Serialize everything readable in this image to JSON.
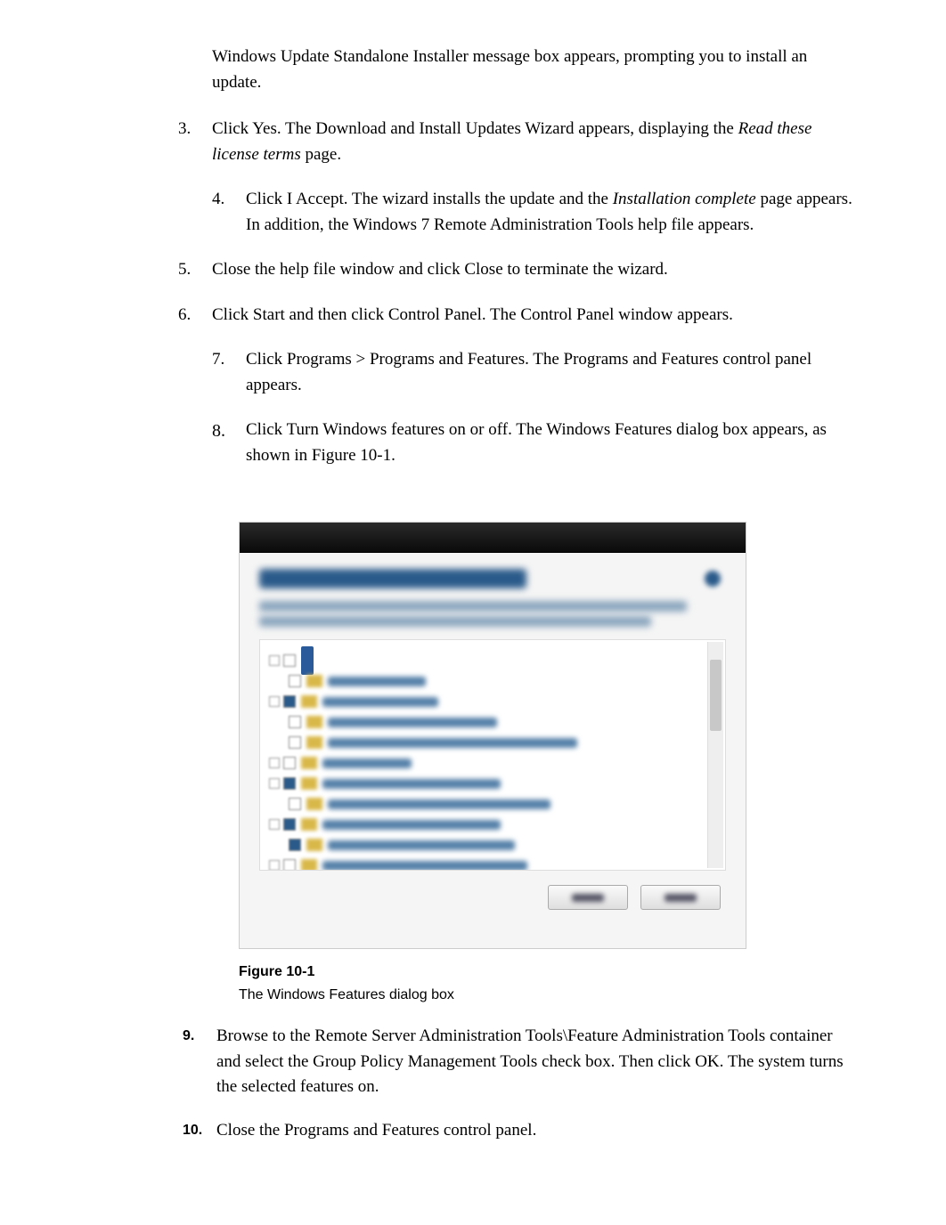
{
  "intro": "Windows Update Standalone Installer message box appears, prompting you to install an update.",
  "steps": {
    "s3": {
      "num": "3.",
      "text_a": "Click Yes. The Download and Install Updates Wizard appears, displaying the ",
      "italic": "Read these license terms",
      "text_b": " page."
    },
    "s4": {
      "num": "4.",
      "text_a": "Click I Accept. The wizard installs the update and the ",
      "italic": "Installation complete",
      "text_b": " page appears. In addition, the Windows 7 Remote Administration Tools help file appears."
    },
    "s5": {
      "num": "5.",
      "text": "Close the help file window and click Close to terminate the wizard."
    },
    "s6": {
      "num": "6.",
      "text": "Click Start and then click Control Panel. The Control Panel window appears."
    },
    "s7": {
      "num": "7.",
      "text": "Click Programs > Programs and Features. The Programs and Features control panel appears."
    },
    "s8": {
      "num": "8.",
      "text": "Click Turn Windows features on or off. The Windows Features dialog box appears, as shown in Figure 10-1."
    },
    "s9": {
      "num": "9.",
      "text": "Browse to the Remote Server Administration Tools\\Feature Administration Tools container and select the Group Policy Management Tools check box. Then click OK. The system turns the selected features on."
    },
    "s10": {
      "num": "10.",
      "text": "Close the Programs and Features control panel."
    }
  },
  "figure": {
    "title": "Figure 10-1",
    "desc": "The Windows Features dialog box"
  }
}
